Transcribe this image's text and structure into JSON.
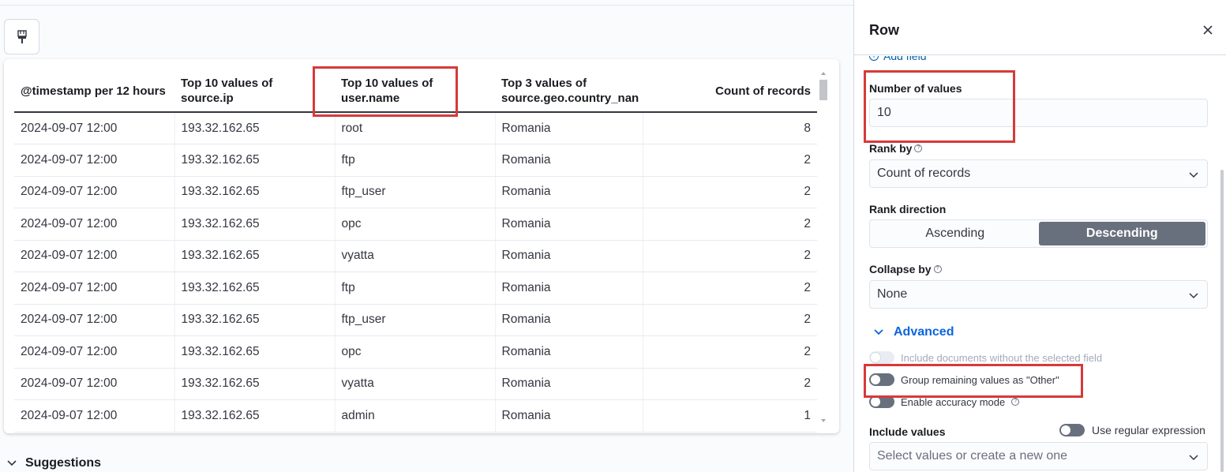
{
  "table": {
    "columns": [
      {
        "label": "@timestamp per 12 hours"
      },
      {
        "label": "Top 10 values of source.ip"
      },
      {
        "label": "Top 10 values of user.name"
      },
      {
        "label": "Top 3 values of source.geo.country_nan"
      },
      {
        "label": "Count of records"
      }
    ],
    "rows": [
      [
        "2024-09-07 12:00",
        "193.32.162.65",
        "root",
        "Romania",
        "8"
      ],
      [
        "2024-09-07 12:00",
        "193.32.162.65",
        "ftp",
        "Romania",
        "2"
      ],
      [
        "2024-09-07 12:00",
        "193.32.162.65",
        "ftp_user",
        "Romania",
        "2"
      ],
      [
        "2024-09-07 12:00",
        "193.32.162.65",
        "opc",
        "Romania",
        "2"
      ],
      [
        "2024-09-07 12:00",
        "193.32.162.65",
        "vyatta",
        "Romania",
        "2"
      ],
      [
        "2024-09-07 12:00",
        "193.32.162.65",
        "ftp",
        "Romania",
        "2"
      ],
      [
        "2024-09-07 12:00",
        "193.32.162.65",
        "ftp_user",
        "Romania",
        "2"
      ],
      [
        "2024-09-07 12:00",
        "193.32.162.65",
        "opc",
        "Romania",
        "2"
      ],
      [
        "2024-09-07 12:00",
        "193.32.162.65",
        "vyatta",
        "Romania",
        "2"
      ],
      [
        "2024-09-07 12:00",
        "193.32.162.65",
        "admin",
        "Romania",
        "1"
      ]
    ]
  },
  "suggestions": {
    "label": "Suggestions"
  },
  "flyout": {
    "title": "Row",
    "add_field": "Add field",
    "number_of_values": {
      "label": "Number of values",
      "value": "10"
    },
    "rank_by": {
      "label": "Rank by",
      "value": "Count of records"
    },
    "rank_direction": {
      "label": "Rank direction",
      "options": [
        "Ascending",
        "Descending"
      ],
      "selected": "Descending"
    },
    "collapse_by": {
      "label": "Collapse by",
      "value": "None"
    },
    "advanced": {
      "label": "Advanced"
    },
    "toggles": {
      "include_docs": "Include documents without the selected field",
      "group_other": "Group remaining values as \"Other\"",
      "accuracy": "Enable accuracy mode"
    },
    "include_values": {
      "label": "Include values",
      "regex_label": "Use regular expression",
      "placeholder": "Select values or create a new one"
    }
  },
  "colors": {
    "highlight": "#d63a3a",
    "accent": "#0b64dd",
    "segment_active": "#69707d"
  }
}
